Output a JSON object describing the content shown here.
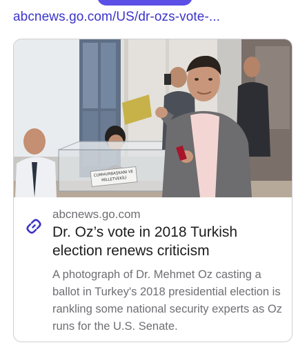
{
  "header": {
    "url": "abcnews.go.com/US/dr-ozs-vote-..."
  },
  "card": {
    "source": "abcnews.go.com",
    "title": "Dr. Oz’s vote in 2018 Turkish election renews criticism",
    "description": "A photograph of Dr. Mehmet Oz casting a ballot in Turkey's 2018 presidential election is rankling some national security experts as Oz runs for the U.S. Senate.",
    "image": {
      "ballot_box_label_line1": "CUMHURBAŞKANI VE",
      "ballot_box_label_line2": "MİLLETVEKİLİ"
    }
  },
  "colors": {
    "accent": "#3b33c9",
    "pill": "#5b4fe6",
    "title_text": "#1c1c1e",
    "muted_text": "#6e6e73",
    "border": "#cfcfd4"
  },
  "icons": {
    "link": "link-icon"
  }
}
